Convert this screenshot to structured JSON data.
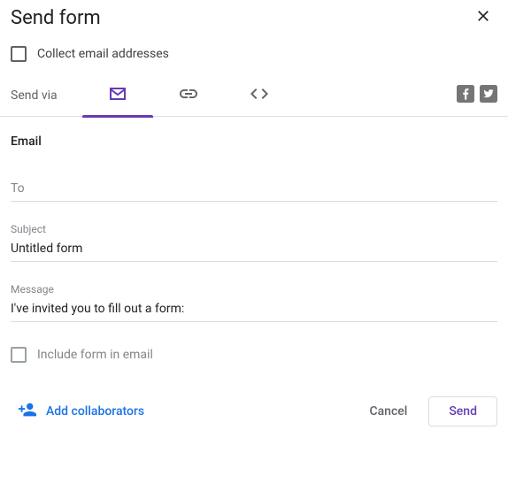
{
  "dialog": {
    "title": "Send form",
    "collect_label": "Collect email addresses",
    "send_via_label": "Send via",
    "tabs": [
      "email",
      "link",
      "embed"
    ],
    "active_tab": "email"
  },
  "email_section": {
    "title": "Email",
    "to_label": "To",
    "to_value": "",
    "subject_label": "Subject",
    "subject_value": "Untitled form",
    "message_label": "Message",
    "message_value": "I've invited you to fill out a form:",
    "include_label": "Include form in email"
  },
  "footer": {
    "add_collaborators": "Add collaborators",
    "cancel": "Cancel",
    "send": "Send"
  },
  "social": [
    "facebook",
    "twitter"
  ]
}
